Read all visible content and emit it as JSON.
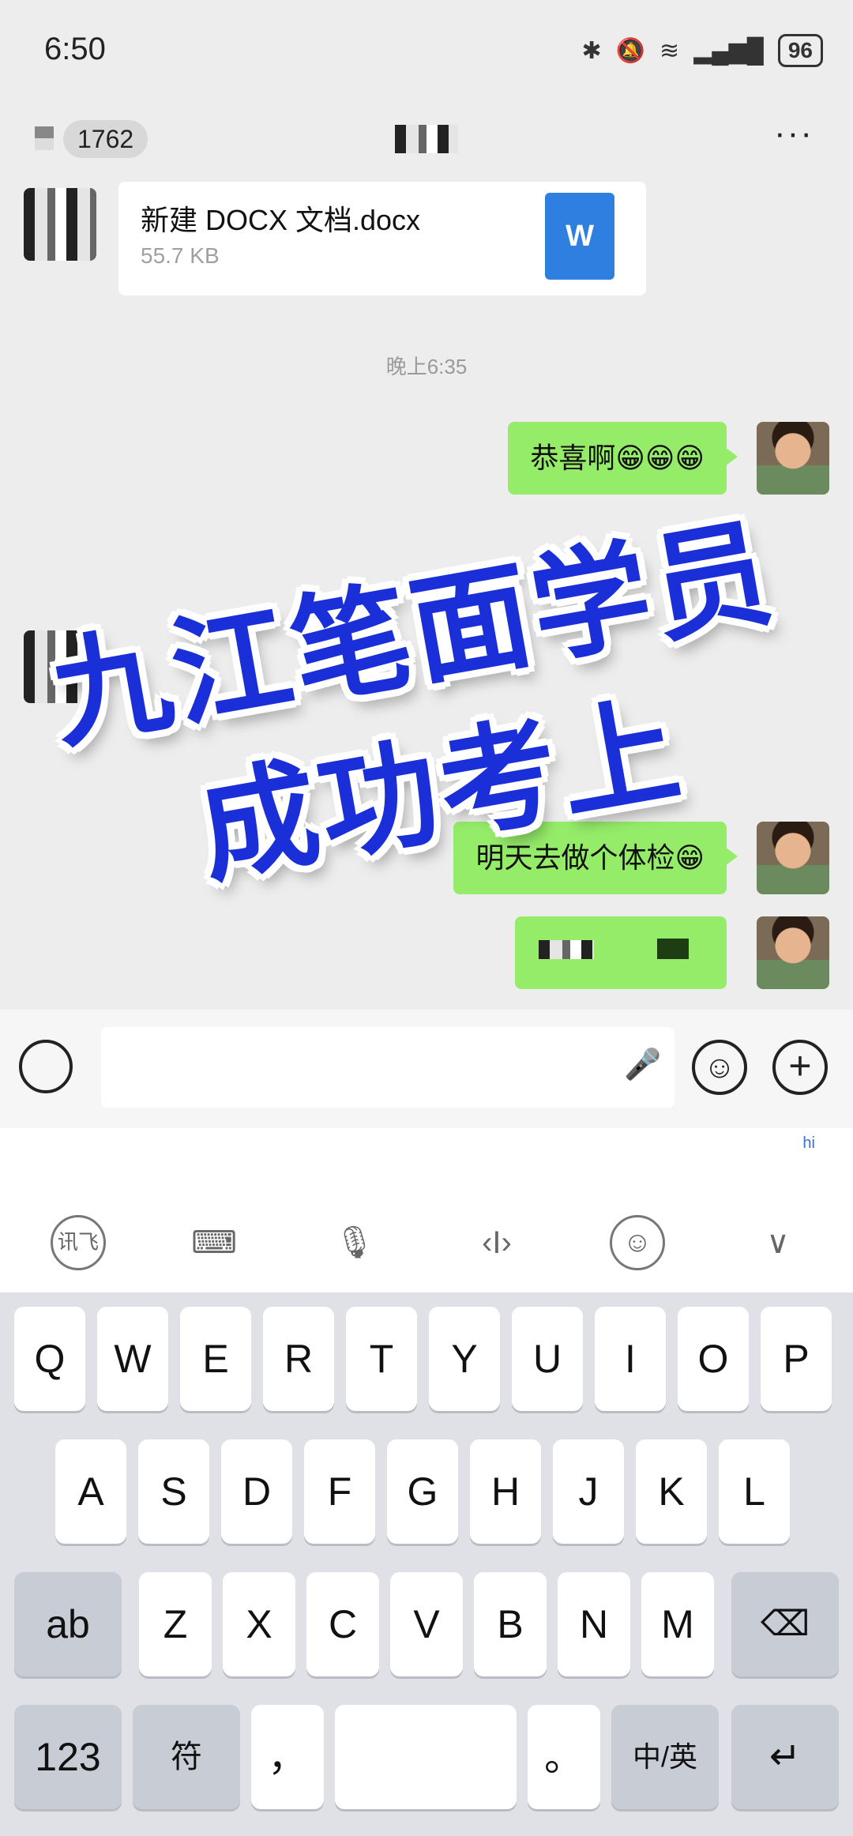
{
  "status_bar": {
    "time": "6:50",
    "battery": "96"
  },
  "nav": {
    "unread_count": "1762",
    "more": "···"
  },
  "chat": {
    "file": {
      "name": "新建 DOCX 文档.docx",
      "size": "55.7 KB",
      "icon_letter": "W"
    },
    "timestamp_1": "晚上6:35",
    "msg_1": "恭喜啊😁😁😁",
    "msg_2": "明天去做个体检😁"
  },
  "overlay": {
    "line1": "九江笔面学员",
    "line2": "成功考上"
  },
  "input_bar": {
    "emoji": "☺",
    "plus": "+"
  },
  "keyboard_toolbar": {
    "hi": "hi",
    "ime_label": "讯飞"
  },
  "keyboard": {
    "row1": [
      "Q",
      "W",
      "E",
      "R",
      "T",
      "Y",
      "U",
      "I",
      "O",
      "P"
    ],
    "row2": [
      "A",
      "S",
      "D",
      "F",
      "G",
      "H",
      "J",
      "K",
      "L"
    ],
    "row3": [
      "Z",
      "X",
      "C",
      "V",
      "B",
      "N",
      "M"
    ],
    "shift_label": "ab",
    "num_label": "123",
    "symbol_label": "符",
    "comma": "，",
    "period": "。",
    "lang_label": "中/英",
    "backspace": "⌫",
    "enter": "↵"
  },
  "colors": {
    "bubble_green": "#95ec69",
    "overlay_blue": "#1a2fd8",
    "doc_blue": "#2f7fe0"
  }
}
